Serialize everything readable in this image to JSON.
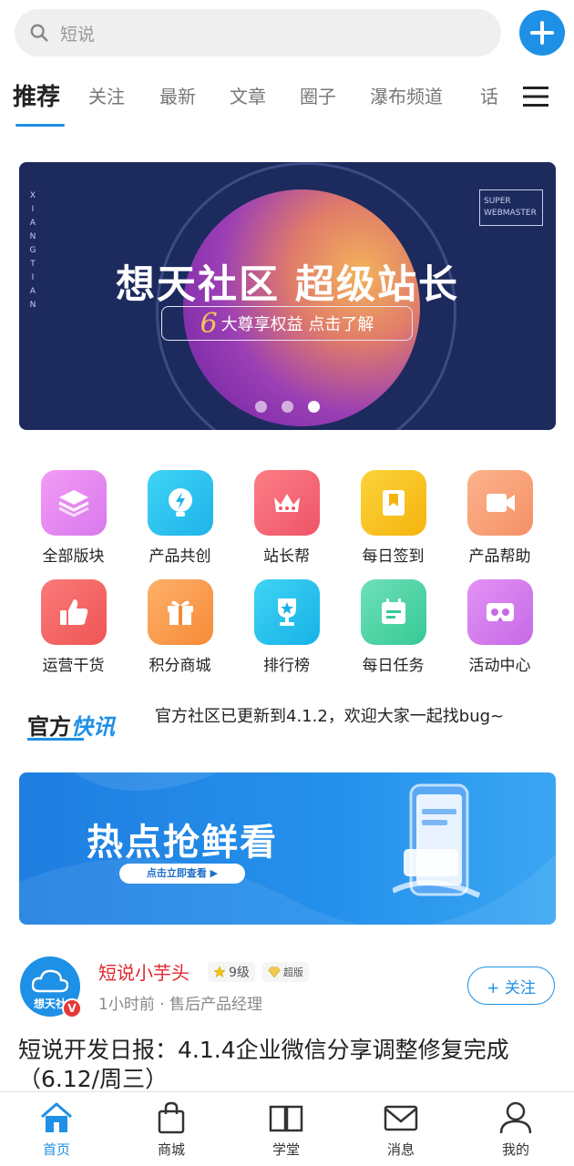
{
  "search": {
    "placeholder": "短说"
  },
  "tabs": [
    {
      "label": "推荐",
      "active": true
    },
    {
      "label": "关注"
    },
    {
      "label": "最新"
    },
    {
      "label": "文章"
    },
    {
      "label": "圈子"
    },
    {
      "label": "瀑布频道"
    },
    {
      "label": "话"
    }
  ],
  "banner": {
    "headline": "想天社区 超级站长",
    "pill_number": "6",
    "pill_text": "大尊享权益 点击了解",
    "vertical_text": "XIANGTIAN",
    "tag_line1": "SUPER",
    "tag_line2": "WEBMASTER",
    "slides": 3,
    "active_slide": 3
  },
  "grid": [
    {
      "label": "全部版块",
      "icon": "layers-icon",
      "color": "#e98af3"
    },
    {
      "label": "产品共创",
      "icon": "lightbulb-icon",
      "color": "#2bc7f0"
    },
    {
      "label": "站长帮",
      "icon": "crown-icon",
      "color": "#f56b7a"
    },
    {
      "label": "每日签到",
      "icon": "bookmark-icon",
      "color": "#f7c21f"
    },
    {
      "label": "产品帮助",
      "icon": "video-icon",
      "color": "#f9a37a"
    },
    {
      "label": "运营干货",
      "icon": "thumbs-up-icon",
      "color": "#f76b6b"
    },
    {
      "label": "积分商城",
      "icon": "gift-icon",
      "color": "#fb9a4e"
    },
    {
      "label": "排行榜",
      "icon": "trophy-icon",
      "color": "#22c4ec"
    },
    {
      "label": "每日任务",
      "icon": "calendar-icon",
      "color": "#4fd6a8"
    },
    {
      "label": "活动中心",
      "icon": "vr-glasses-icon",
      "color": "#d67ef0"
    }
  ],
  "news": {
    "logo_a": "官方",
    "logo_b": "快讯",
    "text": "官方社区已更新到4.1.2，欢迎大家一起找bug~"
  },
  "promo": {
    "title": "热点抢鲜看",
    "button": "点击立即查看 ▶"
  },
  "post": {
    "avatar_text": "想天社",
    "author": "短说小芋头",
    "level": "9级",
    "vip": "超版",
    "meta": "1小时前 · 售后产品经理",
    "follow_label": "+ 关注",
    "title": "短说开发日报：4.1.4企业微信分享调整修复完成（6.12/周三）"
  },
  "bottom_nav": [
    {
      "label": "首页",
      "icon": "home-icon",
      "active": true
    },
    {
      "label": "商城",
      "icon": "shopping-bag-icon"
    },
    {
      "label": "学堂",
      "icon": "book-icon"
    },
    {
      "label": "消息",
      "icon": "mail-icon"
    },
    {
      "label": "我的",
      "icon": "user-icon"
    }
  ],
  "colors": {
    "accent": "#1e90e5",
    "author": "#e0272d"
  }
}
